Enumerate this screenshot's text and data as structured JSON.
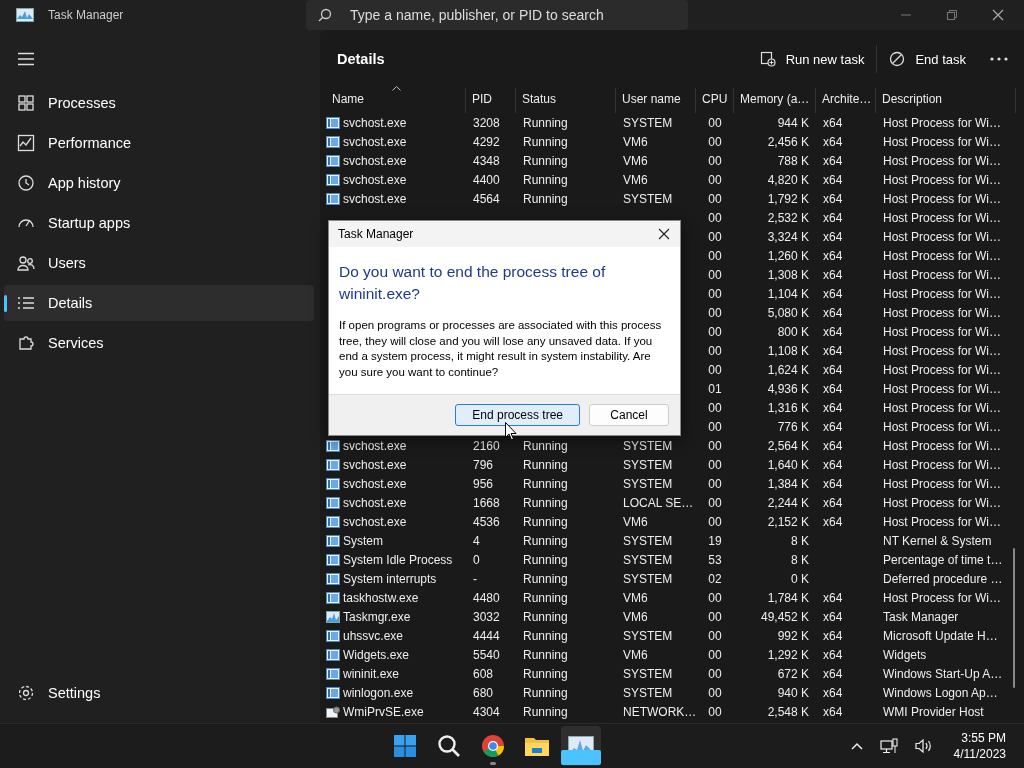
{
  "window": {
    "title": "Task Manager"
  },
  "search": {
    "placeholder": "Type a name, publisher, or PID to search"
  },
  "sidebar": {
    "items": [
      {
        "label": "Processes",
        "kind": "processes",
        "selected": false
      },
      {
        "label": "Performance",
        "kind": "performance",
        "selected": false
      },
      {
        "label": "App history",
        "kind": "history",
        "selected": false
      },
      {
        "label": "Startup apps",
        "kind": "startup",
        "selected": false
      },
      {
        "label": "Users",
        "kind": "users",
        "selected": false
      },
      {
        "label": "Details",
        "kind": "details",
        "selected": true
      },
      {
        "label": "Services",
        "kind": "services",
        "selected": false
      }
    ],
    "footer": {
      "label": "Settings"
    }
  },
  "page": {
    "title": "Details",
    "actions": [
      {
        "label": "Run new task",
        "kind": "run"
      },
      {
        "label": "End task",
        "kind": "end"
      }
    ]
  },
  "table": {
    "columns": [
      {
        "label": "Name",
        "sorted": true
      },
      {
        "label": "PID",
        "sorted": false
      },
      {
        "label": "Status",
        "sorted": false
      },
      {
        "label": "User name",
        "sorted": false
      },
      {
        "label": "CPU",
        "sorted": false
      },
      {
        "label": "Memory (a…",
        "sorted": false
      },
      {
        "label": "Archite…",
        "sorted": false
      },
      {
        "label": "Description",
        "sorted": false
      }
    ],
    "rows": [
      {
        "kind": "service",
        "name": "svchost.exe",
        "pid": "3208",
        "status": "Running",
        "user": "SYSTEM",
        "cpu": "00",
        "memory": "944 K",
        "arch": "x64",
        "description": "Host Process for Wi…"
      },
      {
        "kind": "service",
        "name": "svchost.exe",
        "pid": "4292",
        "status": "Running",
        "user": "VM6",
        "cpu": "00",
        "memory": "2,456 K",
        "arch": "x64",
        "description": "Host Process for Wi…"
      },
      {
        "kind": "service",
        "name": "svchost.exe",
        "pid": "4348",
        "status": "Running",
        "user": "VM6",
        "cpu": "00",
        "memory": "788 K",
        "arch": "x64",
        "description": "Host Process for Wi…"
      },
      {
        "kind": "service",
        "name": "svchost.exe",
        "pid": "4400",
        "status": "Running",
        "user": "VM6",
        "cpu": "00",
        "memory": "4,820 K",
        "arch": "x64",
        "description": "Host Process for Wi…"
      },
      {
        "kind": "service",
        "name": "svchost.exe",
        "pid": "4564",
        "status": "Running",
        "user": "SYSTEM",
        "cpu": "00",
        "memory": "1,792 K",
        "arch": "x64",
        "description": "Host Process for Wi…"
      },
      {
        "cpu": "00",
        "memory": "2,532 K",
        "arch": "x64",
        "description": "Host Process for Wi…"
      },
      {
        "cpu": "00",
        "memory": "3,324 K",
        "arch": "x64",
        "description": "Host Process for Wi…"
      },
      {
        "cpu": "00",
        "memory": "1,260 K",
        "arch": "x64",
        "description": "Host Process for Wi…"
      },
      {
        "cpu": "00",
        "memory": "1,308 K",
        "arch": "x64",
        "description": "Host Process for Wi…"
      },
      {
        "cpu": "00",
        "memory": "1,104 K",
        "arch": "x64",
        "description": "Host Process for Wi…"
      },
      {
        "cpu": "00",
        "memory": "5,080 K",
        "arch": "x64",
        "description": "Host Process for Wi…"
      },
      {
        "cpu": "00",
        "memory": "800 K",
        "arch": "x64",
        "description": "Host Process for Wi…"
      },
      {
        "cpu": "00",
        "memory": "1,108 K",
        "arch": "x64",
        "description": "Host Process for Wi…"
      },
      {
        "cpu": "00",
        "memory": "1,624 K",
        "arch": "x64",
        "description": "Host Process for Wi…"
      },
      {
        "cpu": "01",
        "memory": "4,936 K",
        "arch": "x64",
        "description": "Host Process for Wi…"
      },
      {
        "cpu": "00",
        "memory": "1,316 K",
        "arch": "x64",
        "description": "Host Process for Wi…"
      },
      {
        "cpu": "00",
        "memory": "776 K",
        "arch": "x64",
        "description": "Host Process for Wi…"
      },
      {
        "kind": "service",
        "name": "svchost.exe",
        "pid": "2160",
        "status": "Running",
        "user": "SYSTEM",
        "cpu": "00",
        "memory": "2,564 K",
        "arch": "x64",
        "description": "Host Process for Wi…"
      },
      {
        "kind": "service",
        "name": "svchost.exe",
        "pid": "796",
        "status": "Running",
        "user": "SYSTEM",
        "cpu": "00",
        "memory": "1,640 K",
        "arch": "x64",
        "description": "Host Process for Wi…"
      },
      {
        "kind": "service",
        "name": "svchost.exe",
        "pid": "956",
        "status": "Running",
        "user": "SYSTEM",
        "cpu": "00",
        "memory": "1,384 K",
        "arch": "x64",
        "description": "Host Process for Wi…"
      },
      {
        "kind": "service",
        "name": "svchost.exe",
        "pid": "1668",
        "status": "Running",
        "user": "LOCAL SE…",
        "cpu": "00",
        "memory": "2,244 K",
        "arch": "x64",
        "description": "Host Process for Wi…"
      },
      {
        "kind": "service",
        "name": "svchost.exe",
        "pid": "4536",
        "status": "Running",
        "user": "VM6",
        "cpu": "00",
        "memory": "2,152 K",
        "arch": "x64",
        "description": "Host Process for Wi…"
      },
      {
        "kind": "service",
        "name": "System",
        "pid": "4",
        "status": "Running",
        "user": "SYSTEM",
        "cpu": "19",
        "memory": "8 K",
        "description": "NT Kernel & System"
      },
      {
        "kind": "service",
        "name": "System Idle Process",
        "pid": "0",
        "status": "Running",
        "user": "SYSTEM",
        "cpu": "53",
        "memory": "8 K",
        "description": "Percentage of time t…"
      },
      {
        "kind": "service",
        "name": "System interrupts",
        "pid": "-",
        "status": "Running",
        "user": "SYSTEM",
        "cpu": "02",
        "memory": "0 K",
        "description": "Deferred procedure …"
      },
      {
        "kind": "service",
        "name": "taskhostw.exe",
        "pid": "4480",
        "status": "Running",
        "user": "VM6",
        "cpu": "00",
        "memory": "1,784 K",
        "arch": "x64",
        "description": "Host Process for Wi…"
      },
      {
        "kind": "monitor",
        "name": "Taskmgr.exe",
        "pid": "3032",
        "status": "Running",
        "user": "VM6",
        "cpu": "00",
        "memory": "49,452 K",
        "arch": "x64",
        "description": "Task Manager"
      },
      {
        "kind": "service",
        "name": "uhssvc.exe",
        "pid": "4444",
        "status": "Running",
        "user": "SYSTEM",
        "cpu": "00",
        "memory": "992 K",
        "arch": "x64",
        "description": "Microsoft Update H…"
      },
      {
        "kind": "service",
        "name": "Widgets.exe",
        "pid": "5540",
        "status": "Running",
        "user": "VM6",
        "cpu": "00",
        "memory": "1,292 K",
        "arch": "x64",
        "description": "Widgets"
      },
      {
        "kind": "service",
        "name": "wininit.exe",
        "pid": "608",
        "status": "Running",
        "user": "SYSTEM",
        "cpu": "00",
        "memory": "672 K",
        "arch": "x64",
        "description": "Windows Start-Up A…"
      },
      {
        "kind": "service",
        "name": "winlogon.exe",
        "pid": "680",
        "status": "Running",
        "user": "SYSTEM",
        "cpu": "00",
        "memory": "940 K",
        "arch": "x64",
        "description": "Windows Logon Ap…"
      },
      {
        "kind": "tool",
        "name": "WmiPrvSE.exe",
        "pid": "4304",
        "status": "Running",
        "user": "NETWORK…",
        "cpu": "00",
        "memory": "2,548 K",
        "arch": "x64",
        "description": "WMI Provider Host"
      }
    ]
  },
  "dialog": {
    "title": "Task Manager",
    "heading": "Do you want to end the process tree of wininit.exe?",
    "message": "If open programs or processes are associated with this process tree, they will close and you will lose any unsaved data. If you end a system process, it might result in system instability. Are you sure you want to continue?",
    "buttons": [
      {
        "label": "End process tree",
        "default": true
      },
      {
        "label": "Cancel",
        "default": false
      }
    ]
  },
  "taskbar": {
    "apps": [
      {
        "kind": "start",
        "running": false,
        "active": false
      },
      {
        "kind": "search",
        "running": false,
        "active": false
      },
      {
        "kind": "browser",
        "running": true,
        "active": false
      },
      {
        "kind": "folder",
        "running": false,
        "active": false
      },
      {
        "kind": "monitor",
        "running": true,
        "active": true
      }
    ],
    "time": "3:55 PM",
    "date": "4/11/2023"
  }
}
